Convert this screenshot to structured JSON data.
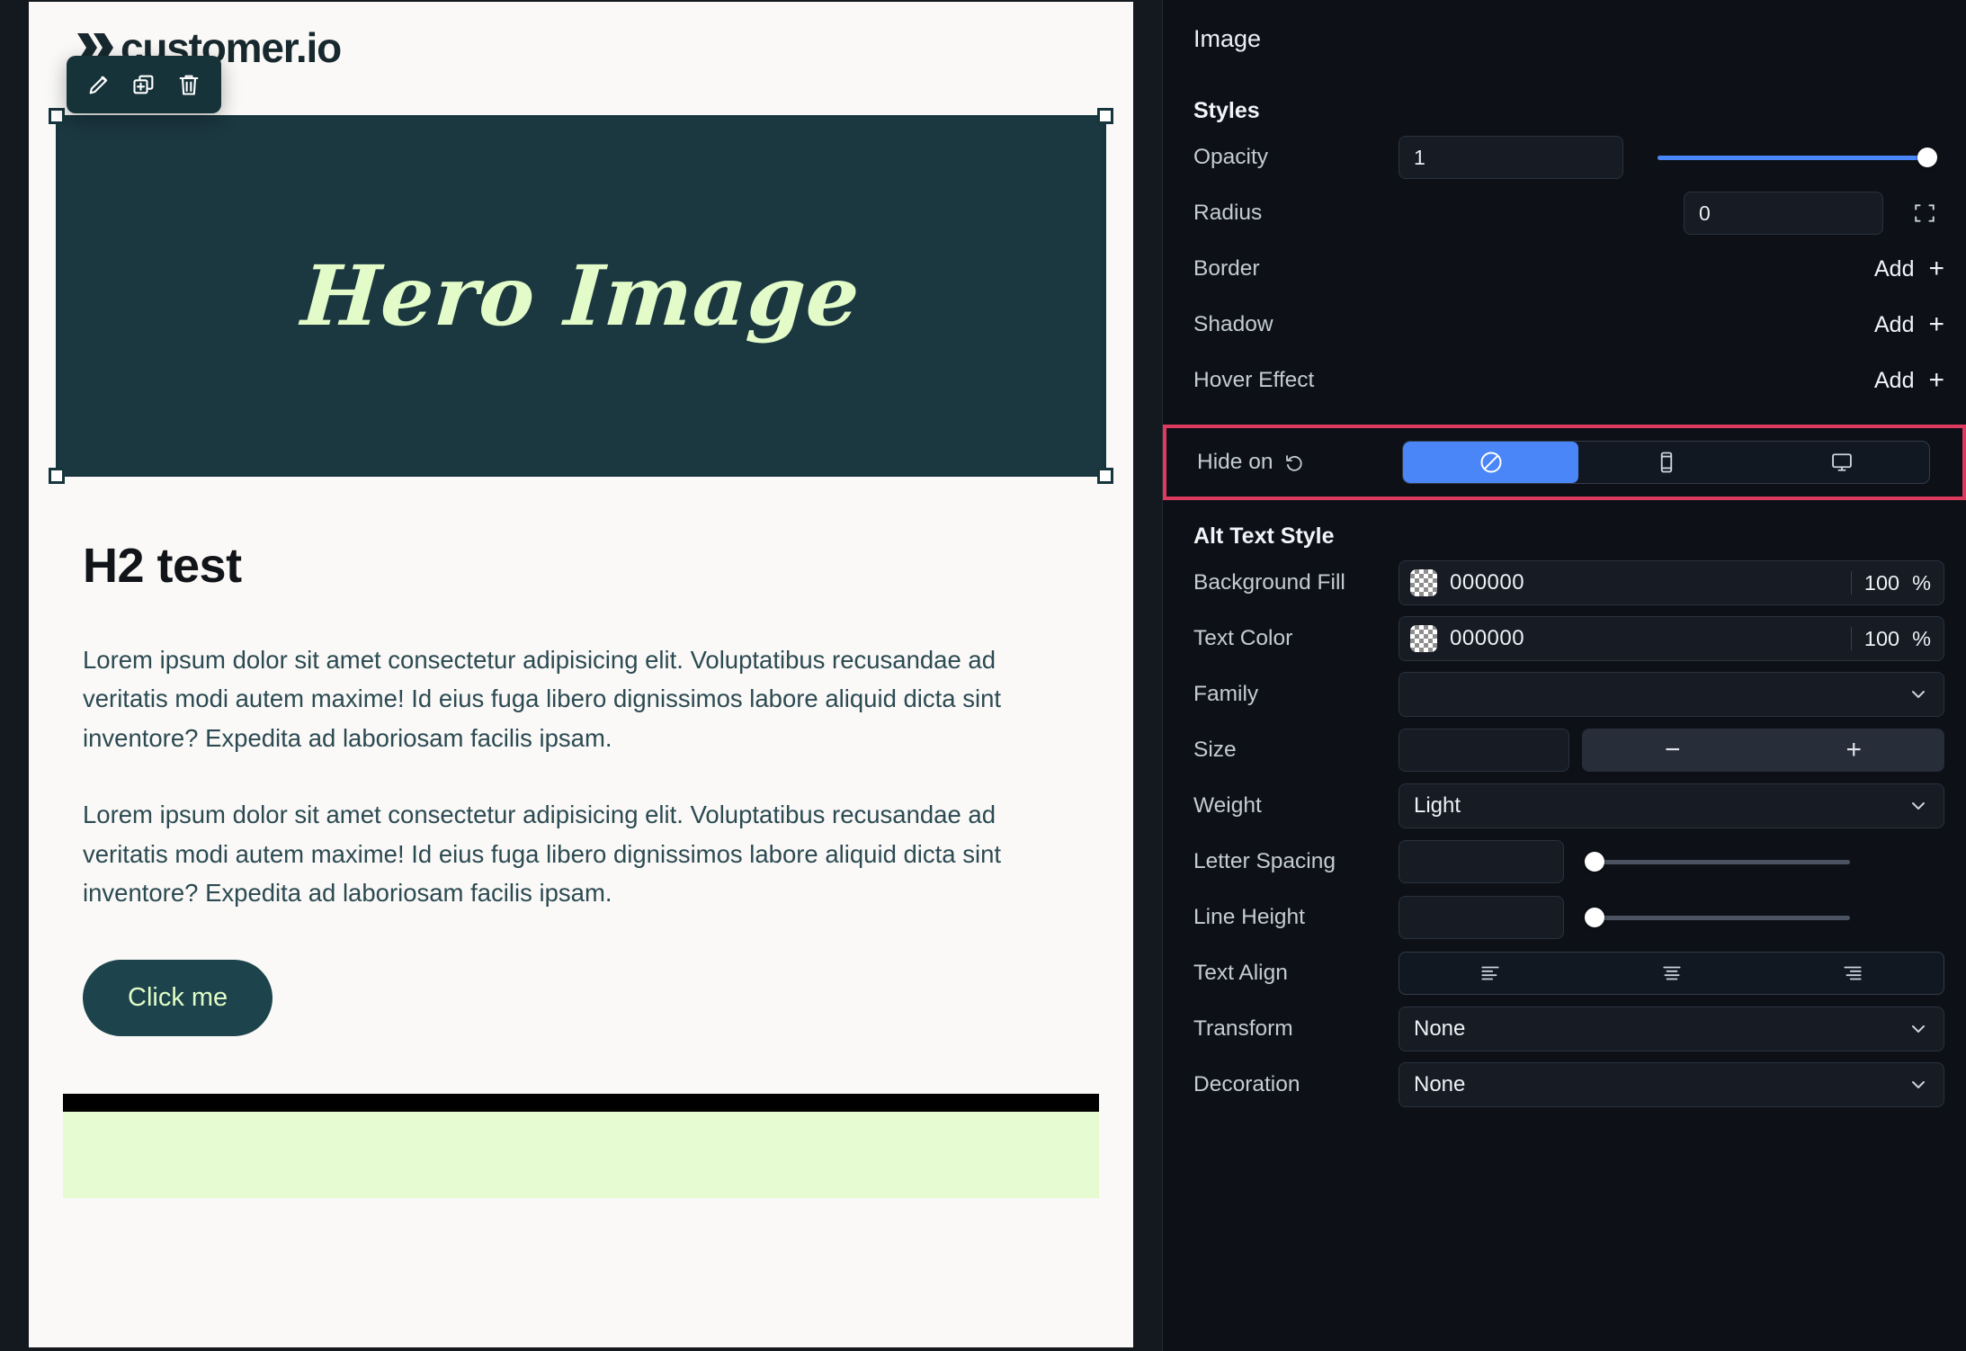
{
  "editor": {
    "element_toolbar": [
      {
        "name": "edit-icon",
        "label": "Edit"
      },
      {
        "name": "duplicate-icon",
        "label": "Duplicate"
      },
      {
        "name": "delete-icon",
        "label": "Delete"
      }
    ]
  },
  "preview": {
    "logo_text": "customer.io",
    "hero_text": "Hero Image",
    "heading": "H2 test",
    "paragraphs": [
      "Lorem ipsum dolor sit amet consectetur adipisicing elit. Voluptatibus recusandae ad veritatis modi autem maxime! Id eius fuga libero dignissimos labore aliquid dicta sint inventore? Expedita ad laboriosam facilis ipsam.",
      "Lorem ipsum dolor sit amet consectetur adipisicing elit. Voluptatibus recusandae ad veritatis modi autem maxime! Id eius fuga libero dignissimos labore aliquid dicta sint inventore? Expedita ad laboriosam facilis ipsam."
    ],
    "cta_label": "Click me",
    "colors": {
      "canvas_bg": "#faf9f7",
      "hero_bg": "#1b3740",
      "hero_text": "#e2fbc8",
      "cta_bg": "#1d444c",
      "cta_text": "#e2fbc8",
      "strip_black": "#000000",
      "strip_green": "#e6fbd1",
      "body_text": "#2c4a52"
    }
  },
  "panel": {
    "title": "Image",
    "styles": {
      "heading": "Styles",
      "opacity": {
        "label": "Opacity",
        "value": "1",
        "slider_percent": 100
      },
      "radius": {
        "label": "Radius",
        "value": "0",
        "corner_icon": "corners-expand-icon"
      },
      "border": {
        "label": "Border",
        "action": "Add"
      },
      "shadow": {
        "label": "Shadow",
        "action": "Add"
      },
      "hover_effect": {
        "label": "Hover Effect",
        "action": "Add"
      },
      "hide_on": {
        "label": "Hide on",
        "reset_icon": "reset-undo-icon",
        "highlighted": true,
        "highlight_color": "#dc3a5e",
        "selected_index": 0,
        "active_color": "#4a86f7",
        "options": [
          {
            "name": "none-prohibit-icon",
            "label": "None"
          },
          {
            "name": "mobile-phone-icon",
            "label": "Mobile"
          },
          {
            "name": "desktop-monitor-icon",
            "label": "Desktop"
          }
        ]
      }
    },
    "alt_text_style": {
      "heading": "Alt Text Style",
      "background_fill": {
        "label": "Background Fill",
        "hex": "000000",
        "opacity": "100",
        "unit": "%"
      },
      "text_color": {
        "label": "Text Color",
        "hex": "000000",
        "opacity": "100",
        "unit": "%"
      },
      "family": {
        "label": "Family",
        "value": ""
      },
      "size": {
        "label": "Size",
        "value": "",
        "minus": "−",
        "plus": "+"
      },
      "weight": {
        "label": "Weight",
        "value": "Light"
      },
      "letter_spacing": {
        "label": "Letter Spacing",
        "value": "",
        "slider_percent": 0
      },
      "line_height": {
        "label": "Line Height",
        "value": "",
        "slider_percent": 0
      },
      "text_align": {
        "label": "Text Align",
        "options": [
          {
            "name": "align-left-icon",
            "label": "Left"
          },
          {
            "name": "align-center-icon",
            "label": "Center"
          },
          {
            "name": "align-right-icon",
            "label": "Right"
          }
        ]
      },
      "transform": {
        "label": "Transform",
        "value": "None"
      },
      "decoration": {
        "label": "Decoration",
        "value": "None"
      }
    }
  }
}
